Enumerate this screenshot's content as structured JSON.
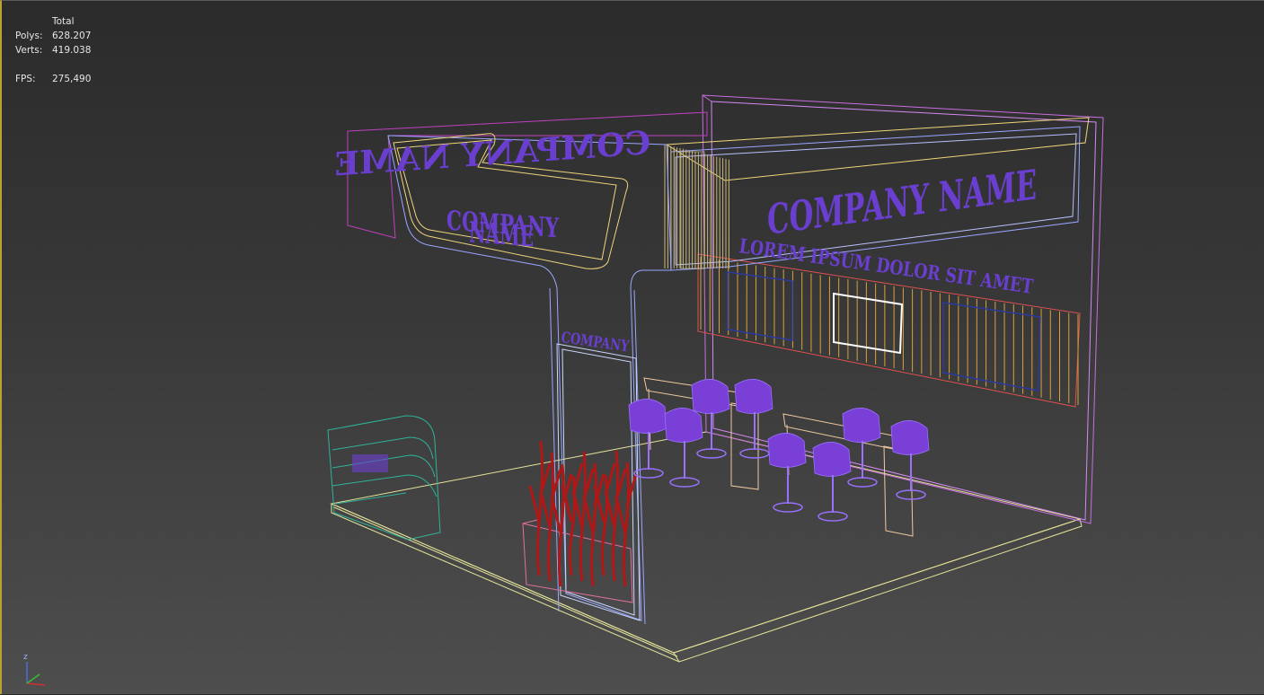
{
  "stats": {
    "header": "Total",
    "polys_label": "Polys:",
    "polys_value": "628.207",
    "verts_label": "Verts:",
    "verts_value": "419.038",
    "fps_label": "FPS:",
    "fps_value": "275,490"
  },
  "scene_text": {
    "sign_mirrored": "COMPANY NAME",
    "sign_left_line1": "COMPANY",
    "sign_left_line2": "NAME",
    "sign_right": "COMPANY NAME",
    "tagline": "LOREM IPSUM DOLOR SIT AMET",
    "column_label": "COMPANY"
  },
  "axis": {
    "z_label": "z"
  },
  "colors": {
    "floor": "#e6e49a",
    "wall": "#c86ee0",
    "header_blue": "#9aa6ff",
    "header_yellow": "#f0d57a",
    "panel_lines": "#d9a23a",
    "text": "#6a3fcf",
    "furniture": "#7a3fd6",
    "plants": "#b01818",
    "showcase": "#2fb39a"
  }
}
